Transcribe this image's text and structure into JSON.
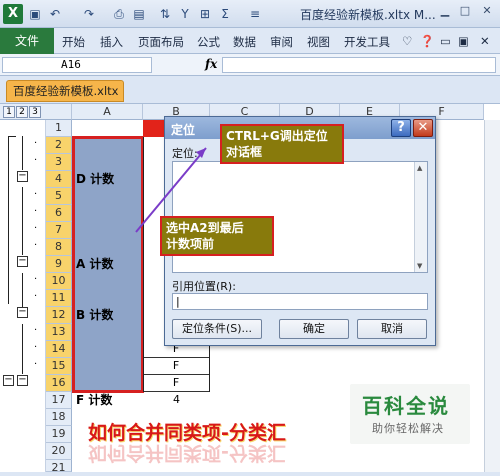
{
  "qat": {
    "excel_icon": "X",
    "title": "百度经验新模板.xltx M...",
    "icons": [
      "save-icon",
      "undo-icon",
      "redo-icon",
      "print-preview-icon",
      "format-icon",
      "sort-icon",
      "filter-icon",
      "borders-icon",
      "sum-icon",
      "align-icon"
    ]
  },
  "ribbon": {
    "file": "文件",
    "tabs": [
      "开始",
      "插入",
      "页面布局",
      "公式",
      "数据",
      "审阅",
      "视图",
      "开发工具"
    ]
  },
  "formula": {
    "namebox": "A16",
    "fx": "fx"
  },
  "workbook": {
    "tab": "百度经验新模板.xltx"
  },
  "grid": {
    "levels": [
      "1",
      "2",
      "3"
    ],
    "cols": [
      "A",
      "B",
      "C",
      "D",
      "E",
      "F"
    ],
    "rows": [
      "1",
      "2",
      "3",
      "4",
      "5",
      "6",
      "7",
      "8",
      "9",
      "10",
      "11",
      "12",
      "13",
      "14",
      "15",
      "16",
      "17",
      "18",
      "19",
      "20",
      "21"
    ],
    "cellsA": {
      "4": "D 计数",
      "9": "A 计数",
      "12": "B 计数",
      "17": "F 计数"
    },
    "cellsB": {
      "14": "F",
      "15": "F",
      "16": "F",
      "17": "4"
    }
  },
  "dialog": {
    "title": "定位",
    "help": "?",
    "close": "✕",
    "goto_label": "定位:",
    "ref_label": "引用位置(R):",
    "special": "定位条件(S)...",
    "ok": "确定",
    "cancel": "取消"
  },
  "callouts": {
    "ctrl_g": "CTRL+G调出定位\n对话框",
    "select": "选中A2到最后\n计数项前"
  },
  "banner": {
    "title": "如何合并同类项-分类汇",
    "logo_main": "百科全说",
    "logo_sub": "助你轻松解决"
  }
}
